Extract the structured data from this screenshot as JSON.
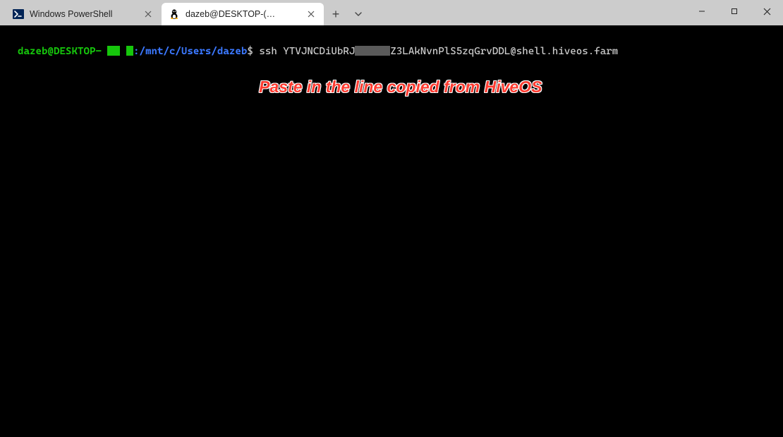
{
  "titlebar": {
    "tabs": [
      {
        "label": "Windows PowerShell",
        "icon": "powershell",
        "active": false
      },
      {
        "label": "dazeb@DESKTOP-(",
        "icon": "tux",
        "active": true,
        "redacted_suffix": true,
        "extra": ")"
      }
    ],
    "newtab_glyph": "+",
    "dropdown_glyph": "⌄"
  },
  "window_controls": {
    "minimize": "—",
    "maximize": "▢",
    "close": "✕"
  },
  "terminal": {
    "prompt": {
      "user_host": "dazeb@DESKTOP-",
      "sep1": " ",
      "sep2": " ",
      "colon": ":",
      "cwd": "/mnt/c/Users/dazeb",
      "dollar": "$ "
    },
    "command": {
      "prefix": "ssh YTVJNCDiUbRJ",
      "suffix": "Z3LAkNvnPlS5zqGrvDDL@shell.hiveos.farm"
    }
  },
  "annotation": {
    "text": "Paste in the line copied from HiveOS"
  }
}
